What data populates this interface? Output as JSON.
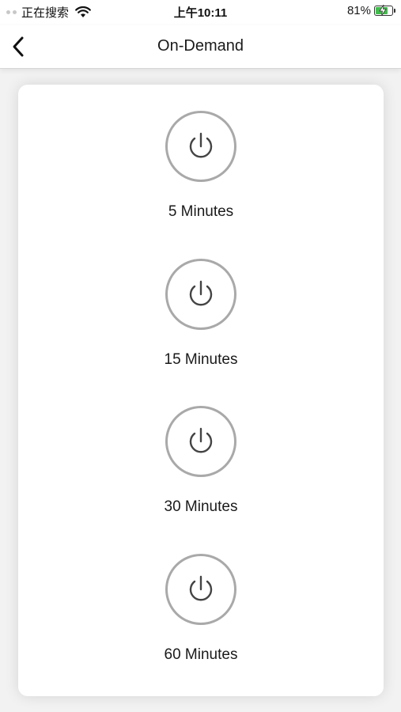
{
  "status_bar": {
    "carrier": "正在搜索",
    "time": "上午10:11",
    "battery_percent": "81%",
    "battery_level": 0.81,
    "charging": true
  },
  "nav": {
    "title": "On-Demand",
    "back_icon": "chevron-left-icon"
  },
  "options": [
    {
      "label": "5 Minutes",
      "icon": "power-icon"
    },
    {
      "label": "15 Minutes",
      "icon": "power-icon"
    },
    {
      "label": "30 Minutes",
      "icon": "power-icon"
    },
    {
      "label": "60 Minutes",
      "icon": "power-icon"
    }
  ],
  "colors": {
    "ring": "#a9a9a9",
    "icon": "#444444",
    "battery_fill": "#3fbf4a",
    "background": "#f2f2f2"
  }
}
